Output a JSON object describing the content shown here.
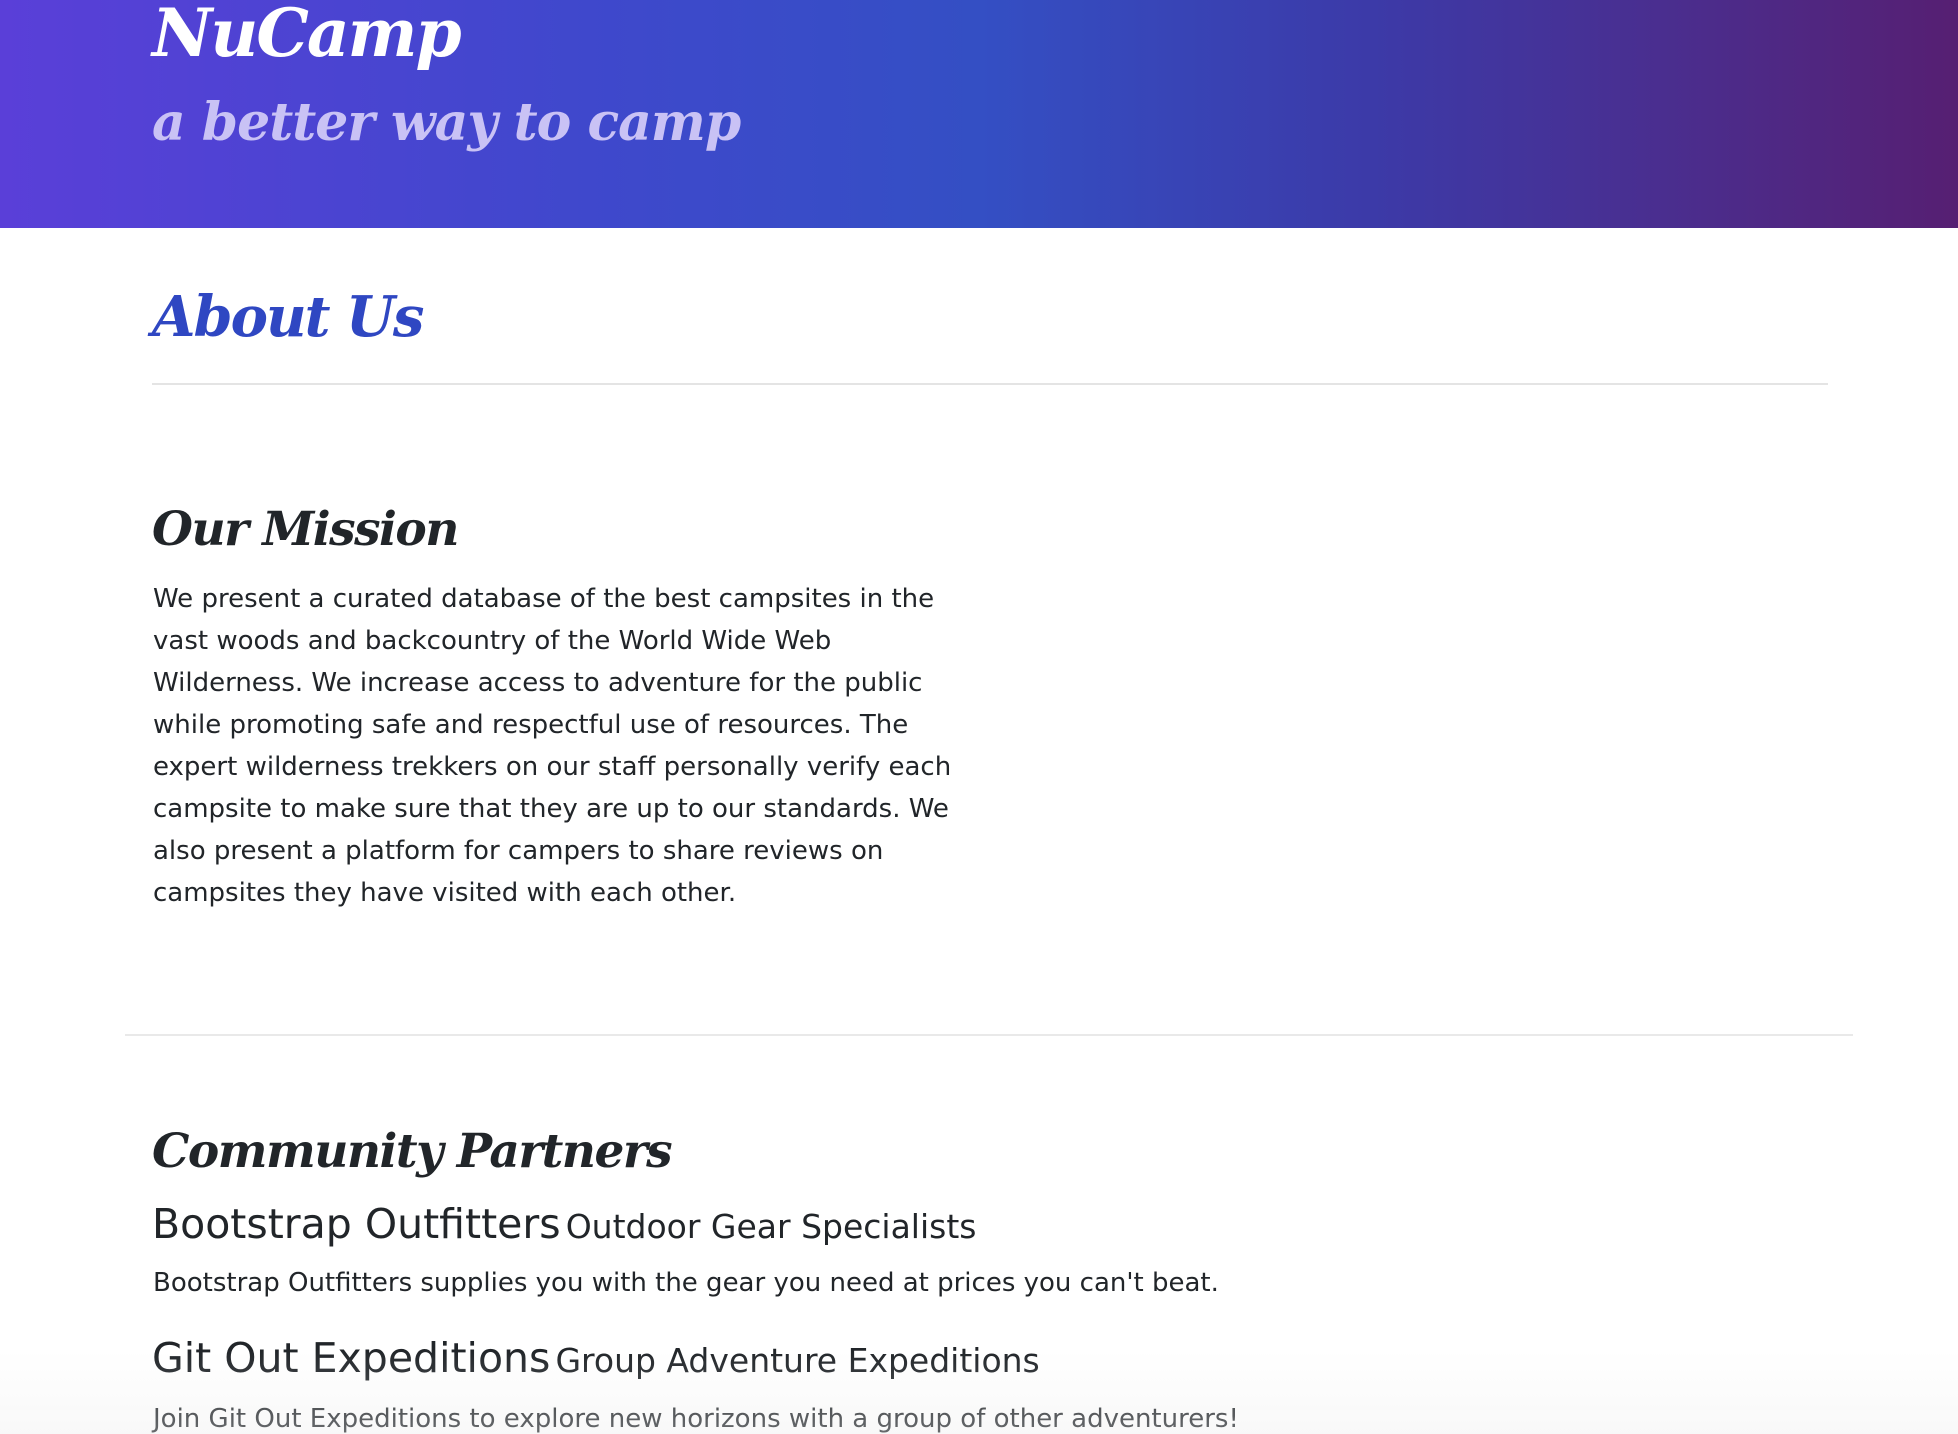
{
  "header": {
    "brand": "NuCamp",
    "tagline": "a better way to camp"
  },
  "about": {
    "title": "About Us"
  },
  "mission": {
    "heading": "Our Mission",
    "text": "We present a curated database of the best campsites in the vast woods and backcountry of the World Wide Web Wilderness. We increase access to adventure for the public while promoting safe and respectful use of resources. The expert wilderness trekkers on our staff personally verify each campsite to make sure that they are up to our standards. We also present a platform for campers to share reviews on campsites they have visited with each other."
  },
  "partners": {
    "heading": "Community Partners",
    "items": [
      {
        "name": "Bootstrap Outfitters",
        "subtitle": "Outdoor Gear Specialists",
        "description": "Bootstrap Outfitters supplies you with the gear you need at prices you can't beat."
      },
      {
        "name": "Git Out Expeditions",
        "subtitle": "Group Adventure Expeditions",
        "description": "Join Git Out Expeditions to explore new horizons with a group of other adventurers!"
      }
    ]
  },
  "colors": {
    "header_gradient_start": "#5a3fd8",
    "header_gradient_end": "#561f72",
    "about_title": "#2f47c2",
    "tagline": "#c9c2f5",
    "text": "#212529"
  }
}
